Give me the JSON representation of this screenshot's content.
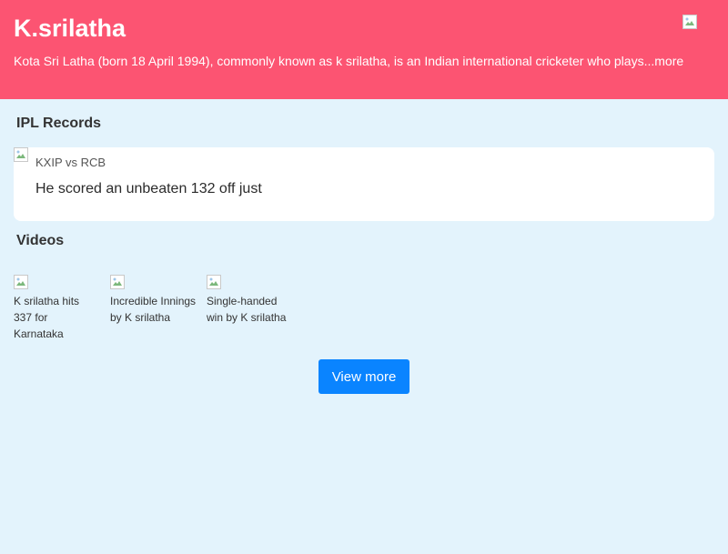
{
  "header": {
    "title": "K.srilatha",
    "description": "Kota Sri Latha (born 18 April 1994), commonly known as k srilatha, is an Indian international cricketer who plays",
    "more_link": "...more",
    "avatar_icon": "broken-image-icon"
  },
  "ipl": {
    "section_title": "IPL Records",
    "record": {
      "match": "KXIP vs RCB",
      "text": "He scored an unbeaten 132 off just",
      "thumb_icon": "broken-image-icon"
    }
  },
  "videos": {
    "section_title": "Videos",
    "items": [
      {
        "caption": "K srilatha hits 337 for Karnataka",
        "thumb_icon": "broken-image-icon"
      },
      {
        "caption": "Incredible Innings by K srilatha",
        "thumb_icon": "broken-image-icon"
      },
      {
        "caption": "Single-handed win by K srilatha",
        "thumb_icon": "broken-image-icon"
      }
    ],
    "view_more_label": "View more"
  },
  "colors": {
    "header_bg": "#fc5472",
    "page_bg": "#e3f3fc",
    "button_bg": "#0a84ff"
  }
}
